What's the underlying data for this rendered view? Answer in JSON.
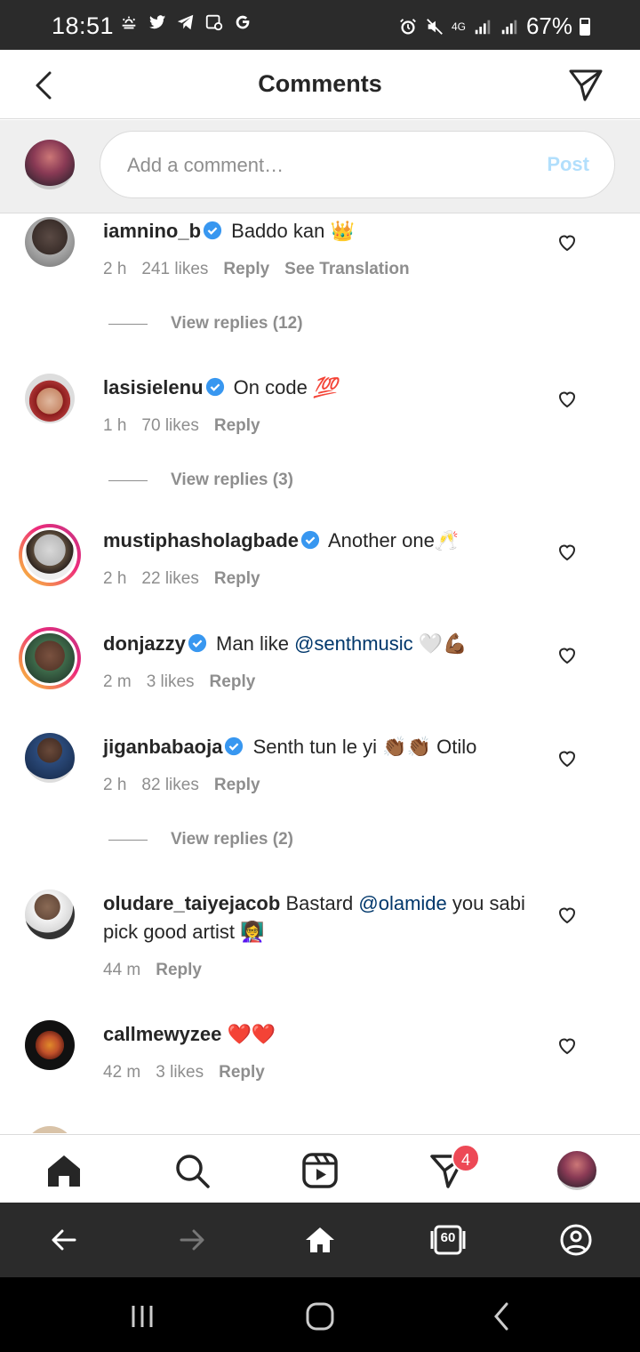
{
  "status_bar": {
    "time": "18:51",
    "network": "4G",
    "battery": "67%",
    "left_icons": [
      "weather-icon",
      "twitter-icon",
      "telegram-icon",
      "notification-icon",
      "google-icon"
    ],
    "right_icons": [
      "alarm-icon",
      "mute-icon",
      "signal-icon",
      "signal-icon",
      "battery-icon"
    ]
  },
  "header": {
    "title": "Comments"
  },
  "composer": {
    "placeholder": "Add a comment…",
    "post_label": "Post"
  },
  "comments": [
    {
      "username": "iamnino_b",
      "verified": true,
      "text": "Baddo kan",
      "emoji": "👑",
      "time": "2 h",
      "likes": "241 likes",
      "reply": "Reply",
      "translate": "See Translation",
      "view_replies": "View replies (12)"
    },
    {
      "username": "lasisielenu",
      "verified": true,
      "text": "On code",
      "emoji": "💯",
      "time": "1 h",
      "likes": "70 likes",
      "reply": "Reply",
      "view_replies": "View replies (3)"
    },
    {
      "username": "mustiphasholagbade",
      "verified": true,
      "text": "Another one",
      "emoji": "🥂",
      "time": "2 h",
      "likes": "22 likes",
      "reply": "Reply"
    },
    {
      "username": "donjazzy",
      "verified": true,
      "text": "Man like",
      "mention": "@senthmusic",
      "emoji": "🤍💪🏾",
      "time": "2 m",
      "likes": "3 likes",
      "reply": "Reply"
    },
    {
      "username": "jiganbabaoja",
      "verified": true,
      "text": "Senth tun le yi",
      "emoji": "👏🏾👏🏾",
      "text_after": "Otilo",
      "time": "2 h",
      "likes": "82 likes",
      "reply": "Reply",
      "view_replies": "View replies (2)"
    },
    {
      "username": "oludare_taiyejacob",
      "verified": false,
      "text": "Bastard",
      "mention": "@olamide",
      "text_after": "you sabi pick good artist",
      "emoji": "👩‍🏫",
      "time": "44 m",
      "reply": "Reply"
    },
    {
      "username": "callmewyzee",
      "verified": false,
      "emoji": "❤️❤️",
      "time": "42 m",
      "likes": "3 likes",
      "reply": "Reply"
    }
  ],
  "bottom_nav": {
    "items": [
      "home-icon",
      "search-icon",
      "reels-icon",
      "direct-icon",
      "profile-avatar"
    ],
    "direct_badge": "4"
  },
  "browser_bar": {
    "tabs_count": "60"
  },
  "colors": {
    "link": "#00376b",
    "verified": "#3897f0",
    "muted": "#8e8e8e",
    "post_disabled": "#b2dffc",
    "badge": "#ed4956"
  }
}
